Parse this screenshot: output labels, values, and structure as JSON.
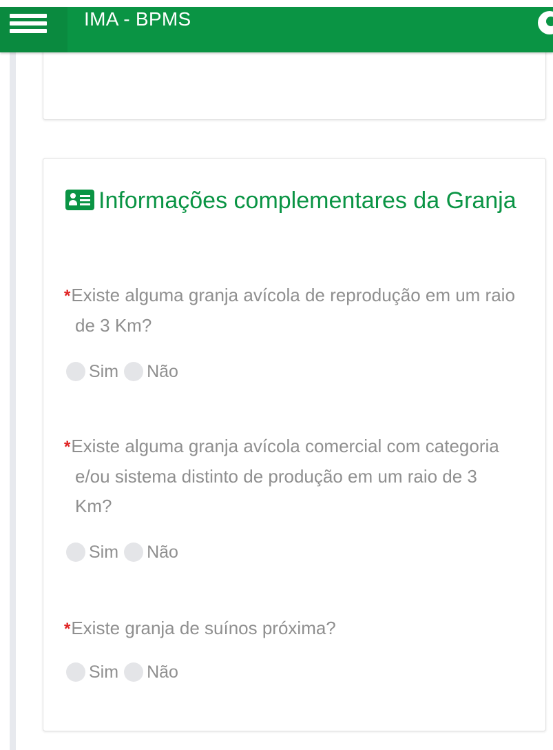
{
  "app_bar": {
    "title": "IMA - BPMS",
    "menu_icon": "hamburger-menu-icon",
    "avatar_icon": "user-avatar-icon",
    "color": "#0a9444"
  },
  "section": {
    "icon": "id-card-icon",
    "title": "Informações complementares da Granja",
    "questions": [
      {
        "required_mark": "*",
        "text": "Existe alguma granja avícola de reprodução em um raio de 3 Km?",
        "options": [
          "Sim",
          "Não"
        ],
        "selected": null
      },
      {
        "required_mark": "*",
        "text": "Existe alguma granja avícola comercial com categoria e/ou sistema distinto de produção em um raio de 3 Km?",
        "options": [
          "Sim",
          "Não"
        ],
        "selected": null
      },
      {
        "required_mark": "*",
        "text": "Existe granja de suínos próxima?",
        "options": [
          "Sim",
          "Não"
        ],
        "selected": null
      }
    ]
  },
  "colors": {
    "accent": "#0a9444",
    "required": "#e02424",
    "muted_text": "#8f8f8f"
  }
}
